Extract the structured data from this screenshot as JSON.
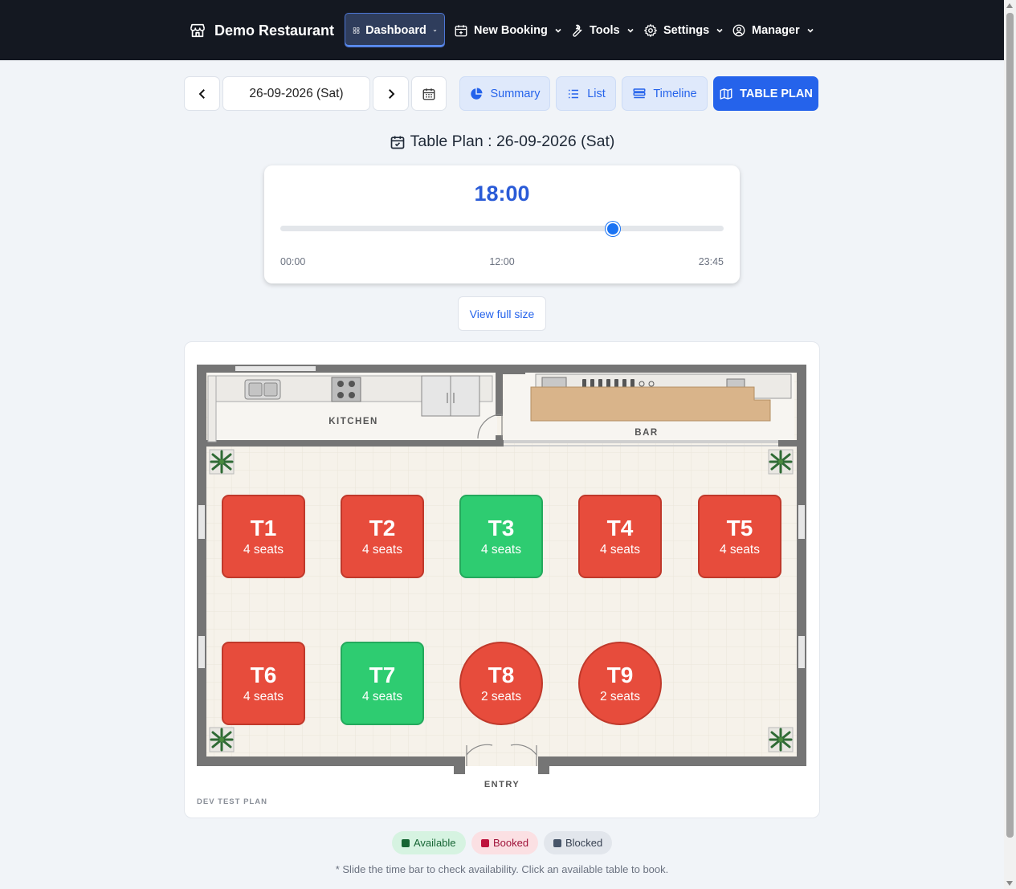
{
  "navbar": {
    "brand": "Demo Restaurant",
    "brand_icon": "storefront-icon",
    "items": [
      {
        "label": "Dashboard",
        "icon": "grid-icon",
        "active": true
      },
      {
        "label": "New Booking",
        "icon": "calendar-plus-icon",
        "active": false
      },
      {
        "label": "Tools",
        "icon": "wrench-icon",
        "active": false
      },
      {
        "label": "Settings",
        "icon": "gear-icon",
        "active": false
      },
      {
        "label": "Manager",
        "icon": "user-circle-icon",
        "active": false
      }
    ]
  },
  "toolbar": {
    "date": "26-09-2026 (Sat)",
    "summary_label": "Summary",
    "list_label": "List",
    "timeline_label": "Timeline",
    "table_plan_label": "TABLE PLAN"
  },
  "plan_title": "Table Plan : 26-09-2026 (Sat)",
  "time_slider": {
    "current": "18:00",
    "min_label": "00:00",
    "mid_label": "12:00",
    "max_label": "23:45",
    "position_fraction": 0.75
  },
  "view_full_label": "View full size",
  "floor_labels": {
    "kitchen": "KITCHEN",
    "bar": "BAR",
    "entry": "ENTRY",
    "dev": "DEV TEST PLAN"
  },
  "tables": [
    {
      "name": "T1",
      "seats": "4 seats",
      "status": "booked",
      "shape": "square"
    },
    {
      "name": "T2",
      "seats": "4 seats",
      "status": "booked",
      "shape": "square"
    },
    {
      "name": "T3",
      "seats": "4 seats",
      "status": "available",
      "shape": "square"
    },
    {
      "name": "T4",
      "seats": "4 seats",
      "status": "booked",
      "shape": "square"
    },
    {
      "name": "T5",
      "seats": "4 seats",
      "status": "booked",
      "shape": "square"
    },
    {
      "name": "T6",
      "seats": "4 seats",
      "status": "booked",
      "shape": "square"
    },
    {
      "name": "T7",
      "seats": "4 seats",
      "status": "available",
      "shape": "square"
    },
    {
      "name": "T8",
      "seats": "2 seats",
      "status": "booked",
      "shape": "round"
    },
    {
      "name": "T9",
      "seats": "2 seats",
      "status": "booked",
      "shape": "round"
    }
  ],
  "legend": {
    "available": "Available",
    "booked": "Booked",
    "blocked": "Blocked"
  },
  "colors": {
    "available": "#2ecc71",
    "booked": "#e74c3c",
    "accent": "#2563eb",
    "navbar": "#141821"
  },
  "footnote": "* Slide the time bar to check availability. Click an available table to book."
}
